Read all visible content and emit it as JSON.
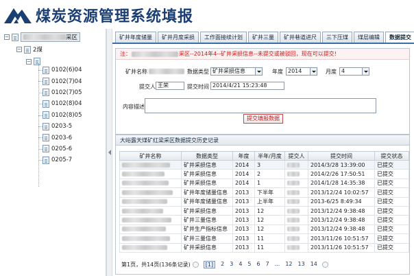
{
  "app": {
    "title": "煤炭资源管理系统填报",
    "brand_color": "#1c3f73"
  },
  "tree": {
    "root_suffix": "采区",
    "sub_toggle": "−",
    "sub_label": "2煤",
    "items": [
      "0102(6)04",
      "0102(7)04",
      "0102(7)05",
      "0102(8)04",
      "0102(8)05",
      "0203-5",
      "0203-6",
      "0205-6",
      "0205-7"
    ]
  },
  "tabs": [
    {
      "label": "矿井年度储量",
      "active": false
    },
    {
      "label": "矿井月度采损",
      "active": false
    },
    {
      "label": "工作面接续计划",
      "active": false
    },
    {
      "label": "矿井三量",
      "active": false
    },
    {
      "label": "矿井巷道进尺",
      "active": false
    },
    {
      "label": "三下压煤",
      "active": false
    },
    {
      "label": "煤层编辑",
      "active": false
    },
    {
      "label": "数据提交",
      "active": true
    }
  ],
  "form": {
    "notice_prefix": "注：",
    "notice_text": "采区--2014年4--矿井采损信息--未提交或被驳回，现在可以提交!",
    "mine_name_label": "矿井名称",
    "data_type_label": "数据类型",
    "data_type_value": "矿井采损信息",
    "year_label": "年度",
    "year_value": "2014",
    "month_label": "月度",
    "month_value": "4",
    "submitter_label": "提交人",
    "submitter_value": "王荣",
    "submit_time_label": "提交时间",
    "submit_time_value": "2014/4/21 15:23:48",
    "content_label": "内容描述",
    "submit_button": "提交填报数据"
  },
  "history": {
    "title": "大峪露天煤矿红梁采区数据提交历史记录",
    "columns": [
      "矿井名称",
      "数据类型",
      "年度",
      "半年/月度",
      "提交人",
      "提交时间",
      "提交状态"
    ],
    "rows": [
      {
        "type": "矿井采损信息",
        "year": "2014",
        "period": "3",
        "time": "2014/3/28 13:39:00",
        "status": "已提交"
      },
      {
        "type": "矿井采损信息",
        "year": "2014",
        "period": "2",
        "time": "2014/2/26 17:50:51",
        "status": "已提交"
      },
      {
        "type": "矿井采损信息",
        "year": "2014",
        "period": "1",
        "time": "2014/1/28 14:35:38",
        "status": "已提交"
      },
      {
        "type": "矿井年度储量信息",
        "year": "2013",
        "period": "下半年",
        "time": "2013/12/24 10:02:57",
        "status": "已提交"
      },
      {
        "type": "矿井年度储量信息",
        "year": "2013",
        "period": "上半年",
        "time": "2013-6/25 8:49:34",
        "status": "已提交"
      },
      {
        "type": "矿井采损信息",
        "year": "2013",
        "period": "12",
        "time": "2013/12/24 9:38:48",
        "status": "已提交"
      },
      {
        "type": "矿井三量信息",
        "year": "2013",
        "period": "12",
        "time": "2013/12/24 9:38:48",
        "status": "已提交"
      },
      {
        "type": "矿井生产指标信息",
        "year": "2013",
        "period": "12",
        "time": "2013/12/24 9:38:48",
        "status": "已提交"
      },
      {
        "type": "矿井三量信息",
        "year": "2013",
        "period": "11",
        "time": "2013/11/26 10:51:57",
        "status": "已提交"
      },
      {
        "type": "矿井采损信息",
        "year": "2013",
        "period": "11",
        "time": "2013/11/26 10:51:57",
        "status": "已提交"
      }
    ],
    "pager": {
      "summary": "第1页，共14页(136条记录)",
      "pages": [
        "[1]",
        "2",
        "3",
        "4",
        "5",
        "6",
        "7",
        "...",
        "12",
        "13",
        "14"
      ]
    }
  }
}
